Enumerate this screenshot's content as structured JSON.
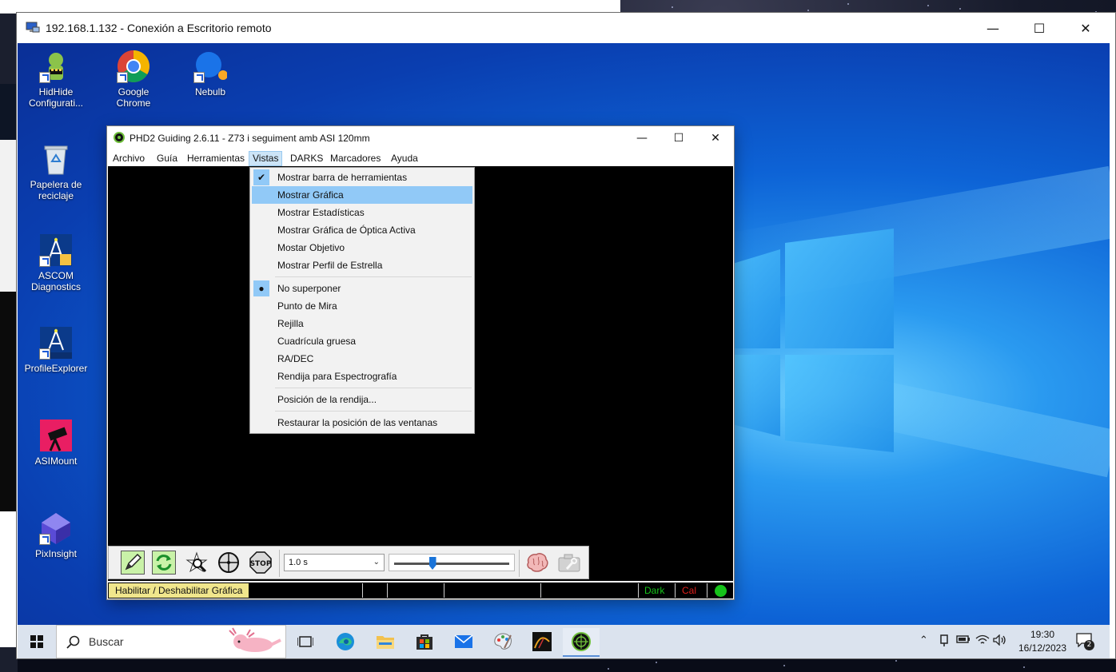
{
  "rdp_window": {
    "title": "192.168.1.132 - Conexión a Escritorio remoto",
    "minimize": "—",
    "maximize": "☐",
    "close": "✕"
  },
  "desktop_icons": [
    {
      "label": "HidHide Configurati...",
      "icon": "hidhide-icon"
    },
    {
      "label": "Google Chrome",
      "icon": "chrome-icon"
    },
    {
      "label": "Nebulb",
      "icon": "nebulb-icon"
    },
    {
      "label": "Papelera de reciclaje",
      "icon": "recycle-bin-icon"
    },
    {
      "label": "ASCOM Diagnostics",
      "icon": "ascom-diagnostics-icon"
    },
    {
      "label": "ProfileExplorer",
      "icon": "ascom-profile-icon"
    },
    {
      "label": "ASIMount",
      "icon": "asimount-icon"
    },
    {
      "label": "PixInsight",
      "icon": "pixinsight-icon"
    }
  ],
  "phd2": {
    "title": "PHD2 Guiding 2.6.11 - Z73 i seguiment amb ASI 120mm",
    "minimize": "—",
    "maximize": "☐",
    "close": "✕",
    "menu": [
      "Archivo",
      "Guía",
      "Herramientas",
      "Vistas",
      "DARKS",
      "Marcadores",
      "Ayuda"
    ],
    "active_menu": "Vistas",
    "toolbar": {
      "exposure": "1.0 s",
      "gamma_level": 0.33
    },
    "status": {
      "message": "Habilitar / Deshabilitar Gráfica",
      "dark_label": "Dark",
      "cal_label": "Cal",
      "dark_color": "#16c21a",
      "cal_color": "#e0201b"
    }
  },
  "vistas_menu": {
    "group1": [
      {
        "label": "Mostrar barra de herramientas",
        "checked": true
      },
      {
        "label": "Mostrar Gráfica",
        "highlighted": true
      },
      {
        "label": "Mostrar Estadísticas"
      },
      {
        "label": "Mostrar Gráfica de Óptica Activa"
      },
      {
        "label": "Mostar Objetivo"
      },
      {
        "label": "Mostrar Perfil de Estrella"
      }
    ],
    "group2": [
      {
        "label": "No superponer",
        "selected": true
      },
      {
        "label": "Punto de Mira"
      },
      {
        "label": "Rejilla"
      },
      {
        "label": "Cuadrícula gruesa"
      },
      {
        "label": "RA/DEC"
      },
      {
        "label": "Rendija para Espectrografía"
      }
    ],
    "group3": [
      {
        "label": "Posición de la rendija..."
      }
    ],
    "group4": [
      {
        "label": "Restaurar la posición de las ventanas"
      }
    ]
  },
  "taskbar": {
    "search_placeholder": "Buscar",
    "time": "19:30",
    "date": "16/12/2023",
    "notification_count": "2"
  },
  "colors": {
    "menu_highlight": "#91c9f7",
    "status_message_bg": "#f0e68c",
    "desktop_blue": "#0d63d6"
  }
}
